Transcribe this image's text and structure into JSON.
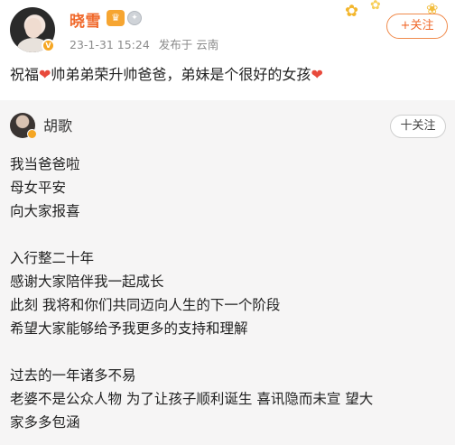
{
  "post": {
    "username": "晓雪",
    "crown_icon": "crown-icon",
    "medal_icon": "medal-icon",
    "date": "23-1-31 15:24",
    "posted_from": "发布于 云南",
    "follow_label": "+关注",
    "text_before": "祝福",
    "text_middle": "帅弟弟荣升帅爸爸，弟妹是个很好的女孩",
    "heart_icon": "heart-icon"
  },
  "repost": {
    "author": "胡歌",
    "follow_label": "十关注",
    "lines": [
      "我当爸爸啦",
      "母女平安",
      "向大家报喜",
      "",
      "入行整二十年",
      "感谢大家陪伴我一起成长",
      "此刻 我将和你们共同迈向人生的下一个阶段",
      "希望大家能够给予我更多的支持和理解",
      "",
      "过去的一年诸多不易",
      "老婆不是公众人物 为了让孩子顺利诞生 喜讯隐而未宣 望大",
      "家多多包涵"
    ]
  },
  "colors": {
    "accent": "#f0682a",
    "heart": "#e84a3c",
    "card_bg": "#f6f5f5"
  }
}
